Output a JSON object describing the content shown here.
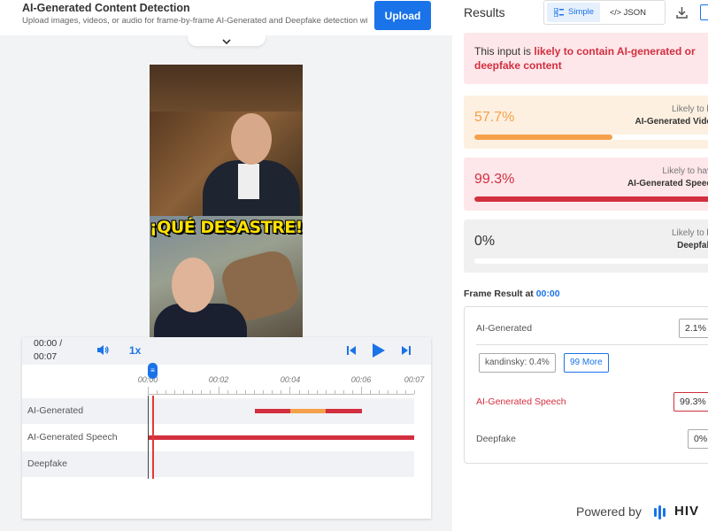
{
  "header": {
    "title": "AI-Generated Content Detection",
    "subtitle": "Upload images, videos, or audio for frame-by-frame AI-Generated and Deepfake detection with...",
    "upload_label": "Upload"
  },
  "video": {
    "caption": "¡QUÉ DESASTRE!"
  },
  "player": {
    "current_time": "00:00 /",
    "total_time": "00:07",
    "speed": "1x"
  },
  "timeline": {
    "ticks": [
      "00:00",
      "00:02",
      "00:04",
      "00:06",
      "00:07"
    ],
    "tracks": [
      {
        "label": "AI-Generated"
      },
      {
        "label": "AI-Generated Speech"
      },
      {
        "label": "Deepfake"
      }
    ]
  },
  "results": {
    "title": "Results",
    "view_simple": "Simple",
    "view_json": "JSON",
    "alert_prefix": "This input is ",
    "alert_highlight": "likely to contain AI-generated or deepfake content",
    "cards": [
      {
        "percent": "57.7%",
        "line1": "Likely to b",
        "line2": "AI-Generated Vide",
        "value": 0.577,
        "color": "#f5a04a",
        "bg": "#fdf0e0"
      },
      {
        "percent": "99.3%",
        "line1": "Likely to hav",
        "line2": "AI-Generated Speec",
        "value": 0.993,
        "color": "#d32f3f",
        "bg": "#fde7ea"
      },
      {
        "percent": "0%",
        "line1": "Likely to b",
        "line2": "Deepfak",
        "value": 0.0,
        "color": "#333333",
        "bg": "#f0f0f0"
      }
    ],
    "frame_result_label": "Frame Result at ",
    "frame_result_time": "00:00",
    "frame": {
      "ai_generated_label": "AI-Generated",
      "ai_generated_value": "2.1%",
      "chip_kandinsky": "kandinsky: 0.4%",
      "chip_more": "99 More",
      "speech_label": "AI-Generated Speech",
      "speech_value": "99.3%",
      "deepfake_label": "Deepfake",
      "deepfake_value": "0%"
    },
    "powered_by": "Powered by",
    "brand": "HIV"
  },
  "colors": {
    "accent": "#1a73e8",
    "danger": "#d32f3f",
    "warning": "#f5a04a"
  }
}
